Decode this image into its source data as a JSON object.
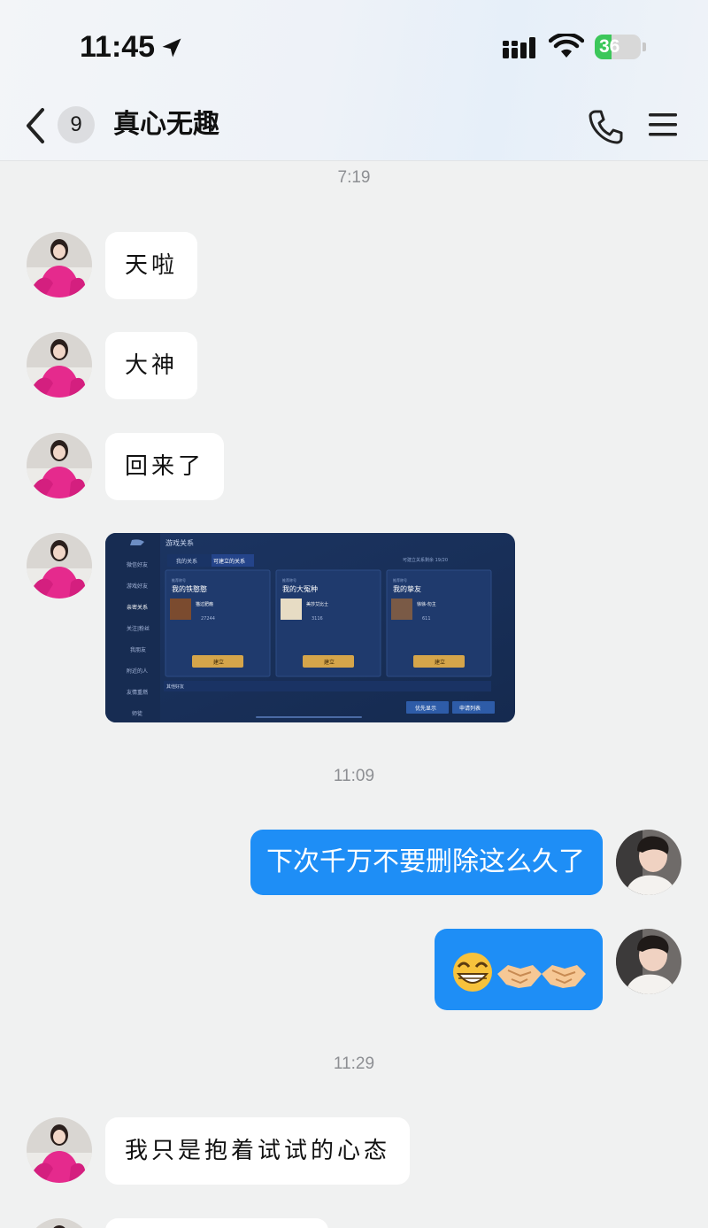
{
  "status_bar": {
    "time": "11:45",
    "battery": {
      "level_text": "36",
      "level_percent": 36,
      "color": "#3cc75a"
    },
    "icons": [
      "location-arrow-icon",
      "cellular-signal-icon",
      "wifi-icon",
      "battery-icon"
    ]
  },
  "nav_bar": {
    "unread_count": "9",
    "title": "真心无趣",
    "icons": [
      "back-chevron-icon",
      "phone-icon",
      "menu-icon"
    ]
  },
  "messages": {
    "ts_1": "7:19",
    "m1": "天啦",
    "m2": "大神",
    "m3": "回来了",
    "screenshot": {
      "header": "游戏关系",
      "tab_mine": "我的关系",
      "tab_available": "可建立的关系",
      "quota_text": "可建立关系剩余 19/20",
      "side_nav": [
        "微信好友",
        "游戏好友",
        "亲密关系",
        "关注|粉丝",
        "我朋友",
        "附近的人",
        "友情重燃",
        "师徒"
      ],
      "cards": [
        {
          "tag": "推荐称号",
          "title": "我的铁憨憨",
          "name": "猫过肥瘾",
          "count": "27244",
          "button": "建立"
        },
        {
          "tag": "推荐称号",
          "title": "我的大冤种",
          "name": "美莎艾比士",
          "count": "3116",
          "button": "建立"
        },
        {
          "tag": "推荐称号",
          "title": "我的挚友",
          "name": "徐徐-勿主",
          "count": "611",
          "button": "建立"
        }
      ],
      "section_label": "其他好友",
      "footer_buttons": [
        "优先显示",
        "申请列表"
      ]
    },
    "ts_2": "11:09",
    "m4": "下次千万不要删除这么久了",
    "m5_emojis": [
      "grinning-face-emoji",
      "handshake-emoji",
      "handshake-emoji"
    ],
    "ts_3": "11:29",
    "m6": "我只是抱着试试的心态"
  },
  "colors": {
    "background": "#f0f1f1",
    "incoming_bubble": "#ffffff",
    "outgoing_bubble": "#1e8ef6",
    "timestamp": "#8d8f93"
  }
}
